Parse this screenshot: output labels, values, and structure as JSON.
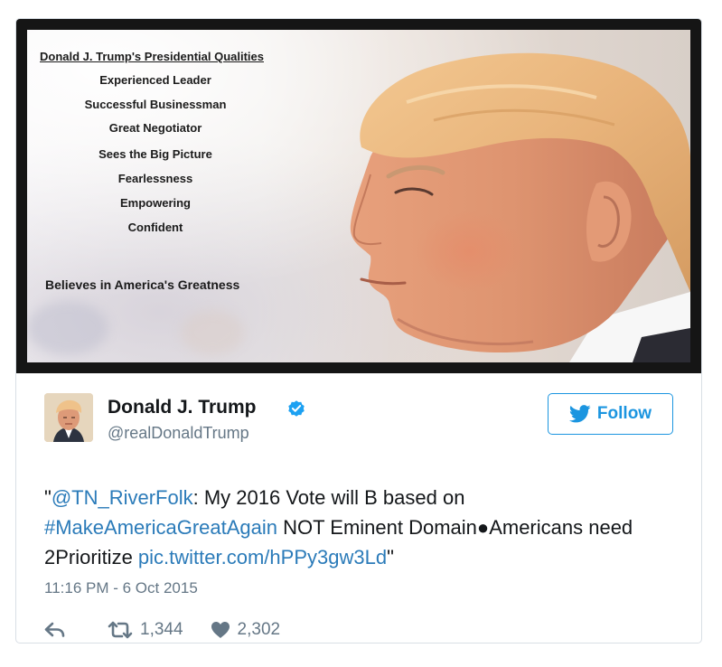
{
  "media": {
    "title": "Donald J. Trump's Presidential Qualities",
    "qualities": [
      "Experienced Leader",
      "Successful Businessman",
      "Great Negotiator",
      "Sees the Big Picture",
      "Fearlessness",
      "Empowering",
      "Confident"
    ],
    "closing": "Believes in America's Greatness"
  },
  "author": {
    "name": "Donald J. Trump",
    "handle": "@realDonaldTrump",
    "verified": true
  },
  "follow": {
    "label": "Follow",
    "color": "#1b95e0"
  },
  "tweet": {
    "open_quote": "\"",
    "mention": "@TN_RiverFolk",
    "text_1": ": My 2016 Vote will B based on",
    "hashtag": "#MakeAmericaGreatAgain",
    "text_2": " NOT Eminent Domain●Americans need 2Prioritize ",
    "pic_link": "pic.twitter.com/hPPy3gw3Ld",
    "close_quote": "\"",
    "timestamp": "11:16 PM - 6 Oct 2015",
    "link_color": "#2b7bb9"
  },
  "stats": {
    "reply_icon": "reply-icon",
    "retweet_icon": "retweet-icon",
    "retweets": "1,344",
    "like_icon": "heart-icon",
    "likes": "2,302"
  }
}
